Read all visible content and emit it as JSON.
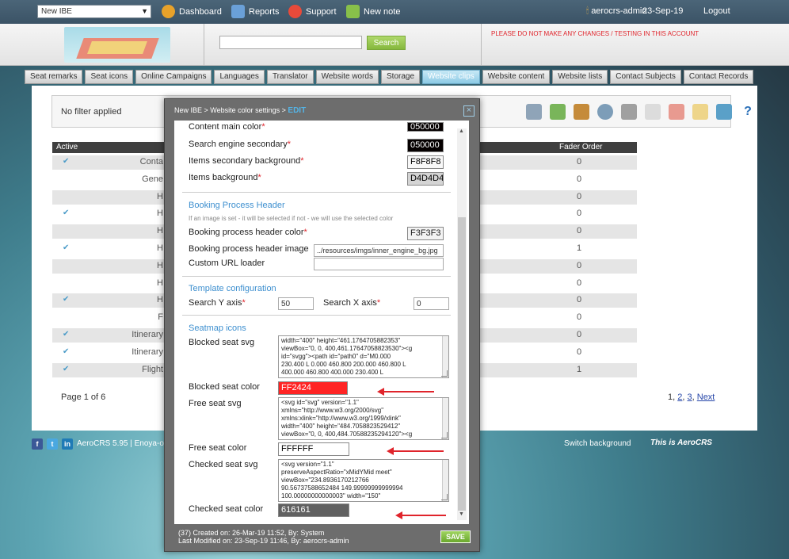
{
  "topbar": {
    "ibe_select": "New IBE",
    "nav": [
      {
        "label": "Dashboard",
        "icon": "dashboard-icon",
        "color": "#e8a22a"
      },
      {
        "label": "Reports",
        "icon": "reports-icon",
        "color": "#6aa0d8"
      },
      {
        "label": "Support",
        "icon": "support-icon",
        "color": "#e84a3a"
      },
      {
        "label": "New note",
        "icon": "note-icon",
        "color": "#88c04a"
      }
    ],
    "user": "aerocrs-admin",
    "date": "23-Sep-19",
    "logout": "Logout"
  },
  "header": {
    "search_button": "Search",
    "warning": "PLEASE DO NOT MAKE ANY CHANGES / TESTING IN THIS ACCOUNT"
  },
  "tabs": [
    {
      "label": "Seat remarks",
      "active": false
    },
    {
      "label": "Seat icons",
      "active": false
    },
    {
      "label": "Online Campaigns",
      "active": false
    },
    {
      "label": "Languages",
      "active": false
    },
    {
      "label": "Translator",
      "active": false
    },
    {
      "label": "Website words",
      "active": false
    },
    {
      "label": "Storage",
      "active": false
    },
    {
      "label": "Website clips",
      "active": true
    },
    {
      "label": "Website content",
      "active": false
    },
    {
      "label": "Website lists",
      "active": false
    },
    {
      "label": "Contact Subjects",
      "active": false
    },
    {
      "label": "Contact Records",
      "active": false
    }
  ],
  "main": {
    "filter_text": "No filter applied",
    "columns": {
      "active": "Active",
      "fader_order": "Fader Order"
    },
    "rows": [
      {
        "active": true,
        "name": "Conta",
        "fader": "0"
      },
      {
        "active": false,
        "name": "Gene",
        "fader": "0"
      },
      {
        "active": false,
        "name": "H",
        "fader": "0"
      },
      {
        "active": true,
        "name": "H",
        "fader": "0"
      },
      {
        "active": false,
        "name": "H",
        "fader": "0"
      },
      {
        "active": true,
        "name": "H",
        "fader": "1"
      },
      {
        "active": false,
        "name": "H",
        "fader": "0"
      },
      {
        "active": false,
        "name": "H",
        "fader": "0"
      },
      {
        "active": true,
        "name": "H",
        "fader": "0"
      },
      {
        "active": false,
        "name": "F",
        "fader": "0"
      },
      {
        "active": true,
        "name": "Itinerary",
        "fader": "0"
      },
      {
        "active": true,
        "name": "Itinerary",
        "fader": "0"
      },
      {
        "active": true,
        "name": "Flight",
        "fader": "1"
      }
    ],
    "page_info": "Page 1 of 6",
    "pager": {
      "current": "1",
      "p2": "2",
      "p3": "3",
      "next": "Next"
    }
  },
  "footer": {
    "version": "AeroCRS 5.95  |  Enoya-or",
    "switch_bg": "Switch background",
    "brand": "This is AeroCRS"
  },
  "modal": {
    "breadcrumb": "New IBE > Website color settings > ",
    "mode": "EDIT",
    "fields_top": [
      {
        "label": "Content main color",
        "value": "050000",
        "bg": "#050000",
        "fg": "#ffffff"
      },
      {
        "label": "Search engine secondary",
        "value": "050000",
        "bg": "#050000",
        "fg": "#ffffff"
      },
      {
        "label": "Items secondary background",
        "value": "F8F8F8",
        "bg": "#F8F8F8",
        "fg": "#000000"
      },
      {
        "label": "Items background",
        "value": "D4D4D4",
        "bg": "#D4D4D4",
        "fg": "#000000"
      }
    ],
    "booking": {
      "title": "Booking Process Header",
      "note": "If an image is set - it will be selected if not - we will use the selected color",
      "color_label": "Booking process header color",
      "color_value": "F3F3F3",
      "image_label": "Booking process header image",
      "image_value": "../resources/imgs/inner_engine_bg.jpg",
      "loader_label": "Custom URL loader",
      "loader_value": ""
    },
    "template": {
      "title": "Template configuration",
      "y_label": "Search Y axis",
      "y_value": "50",
      "x_label": "Search X axis",
      "x_value": "0"
    },
    "seatmap": {
      "title": "Seatmap icons",
      "blocked_svg_label": "Blocked seat svg",
      "blocked_svg": "width=\"400\" height=\"461.1764705882353\"\nviewBox=\"0, 0, 400,461.17647058823530\"><g\nid=\"svgg\"><path id=\"path0\" d=\"M0.000\n230.400 L 0.000 460.800 200.000 460.800 L\n400.000 460.800 400.000 230.400 L",
      "blocked_color_label": "Blocked seat color",
      "blocked_color": "FF2424",
      "free_svg_label": "Free seat svg",
      "free_svg": "<svg id=\"svg\" version=\"1.1\"\nxmlns=\"http://www.w3.org/2000/svg\"\nxmlns:xlink=\"http://www.w3.org/1999/xlink\"\nwidth=\"400\" height=\"484.7058823529412\"\nviewBox=\"0, 0, 400,484.70588235294120\"><g",
      "free_color_label": "Free seat color",
      "free_color": "FFFFFF",
      "checked_svg_label": "Checked seat svg",
      "checked_svg": "<svg version=\"1.1\"\npreserveAspectRatio=\"xMidYMid meet\"\nviewBox=\"234.8936170212766\n90.56737588652484 149.99999999999994\n100.00000000000003\" width=\"150\"",
      "checked_color_label": "Checked seat color",
      "checked_color": "616161"
    },
    "footer_created": "(37) Created on: 26-Mar-19 11:52, By: System",
    "footer_modified": "Last Modified on: 23-Sep-19 11:46, By: aerocrs-admin",
    "save": "SAVE"
  },
  "colors": {
    "accent": "#3d8fcf",
    "required": "#e0242b",
    "save": "#6aa82d"
  }
}
